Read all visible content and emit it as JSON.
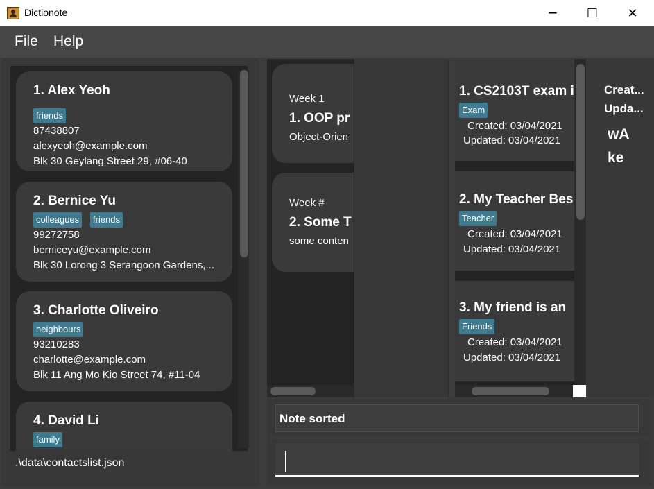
{
  "window": {
    "title": "Dictionote",
    "minimize": "─",
    "maximize": "☐",
    "close": "✕"
  },
  "menu": {
    "file": "File",
    "help": "Help"
  },
  "contacts": [
    {
      "index_name": "1.  Alex Yeoh",
      "tags": [
        "friends"
      ],
      "phone": "87438807",
      "email": "alexyeoh@example.com",
      "address": "Blk 30 Geylang Street 29, #06-40"
    },
    {
      "index_name": "2.  Bernice Yu",
      "tags": [
        "colleagues",
        "friends"
      ],
      "phone": "99272758",
      "email": "berniceyu@example.com",
      "address": "Blk 30 Lorong 3 Serangoon Gardens,..."
    },
    {
      "index_name": "3.  Charlotte Oliveiro",
      "tags": [
        "neighbours"
      ],
      "phone": "93210283",
      "email": "charlotte@example.com",
      "address": "Blk 11 Ang Mo Kio Street 74, #11-04"
    },
    {
      "index_name": "4.  David Li",
      "tags": [
        "family"
      ]
    }
  ],
  "status_left": ".\\data\\contactslist.json",
  "center_notes": [
    {
      "week": "Week 1",
      "title": "1.  OOP pr",
      "content": "Object-Orien"
    },
    {
      "week": "Week #",
      "title": "2.  Some T",
      "content": "some conten"
    }
  ],
  "notes": [
    {
      "title": "1.  CS2103T exam i",
      "tag": "Exam",
      "created": "Created: 03/04/2021",
      "updated": "Updated: 03/04/2021"
    },
    {
      "title": "2.  My Teacher Bes",
      "tag": "Teacher",
      "created": "Created: 03/04/2021",
      "updated": "Updated: 03/04/2021"
    },
    {
      "title": "3.  My friend is an",
      "tag": "Friends",
      "created": "Created: 03/04/2021",
      "updated": "Updated: 03/04/2021"
    }
  ],
  "detail": {
    "created": "Creat...",
    "updated": "Upda...",
    "line1": "wA",
    "line2": "ke"
  },
  "result": {
    "text": "Note sorted"
  },
  "command": {
    "value": ""
  }
}
